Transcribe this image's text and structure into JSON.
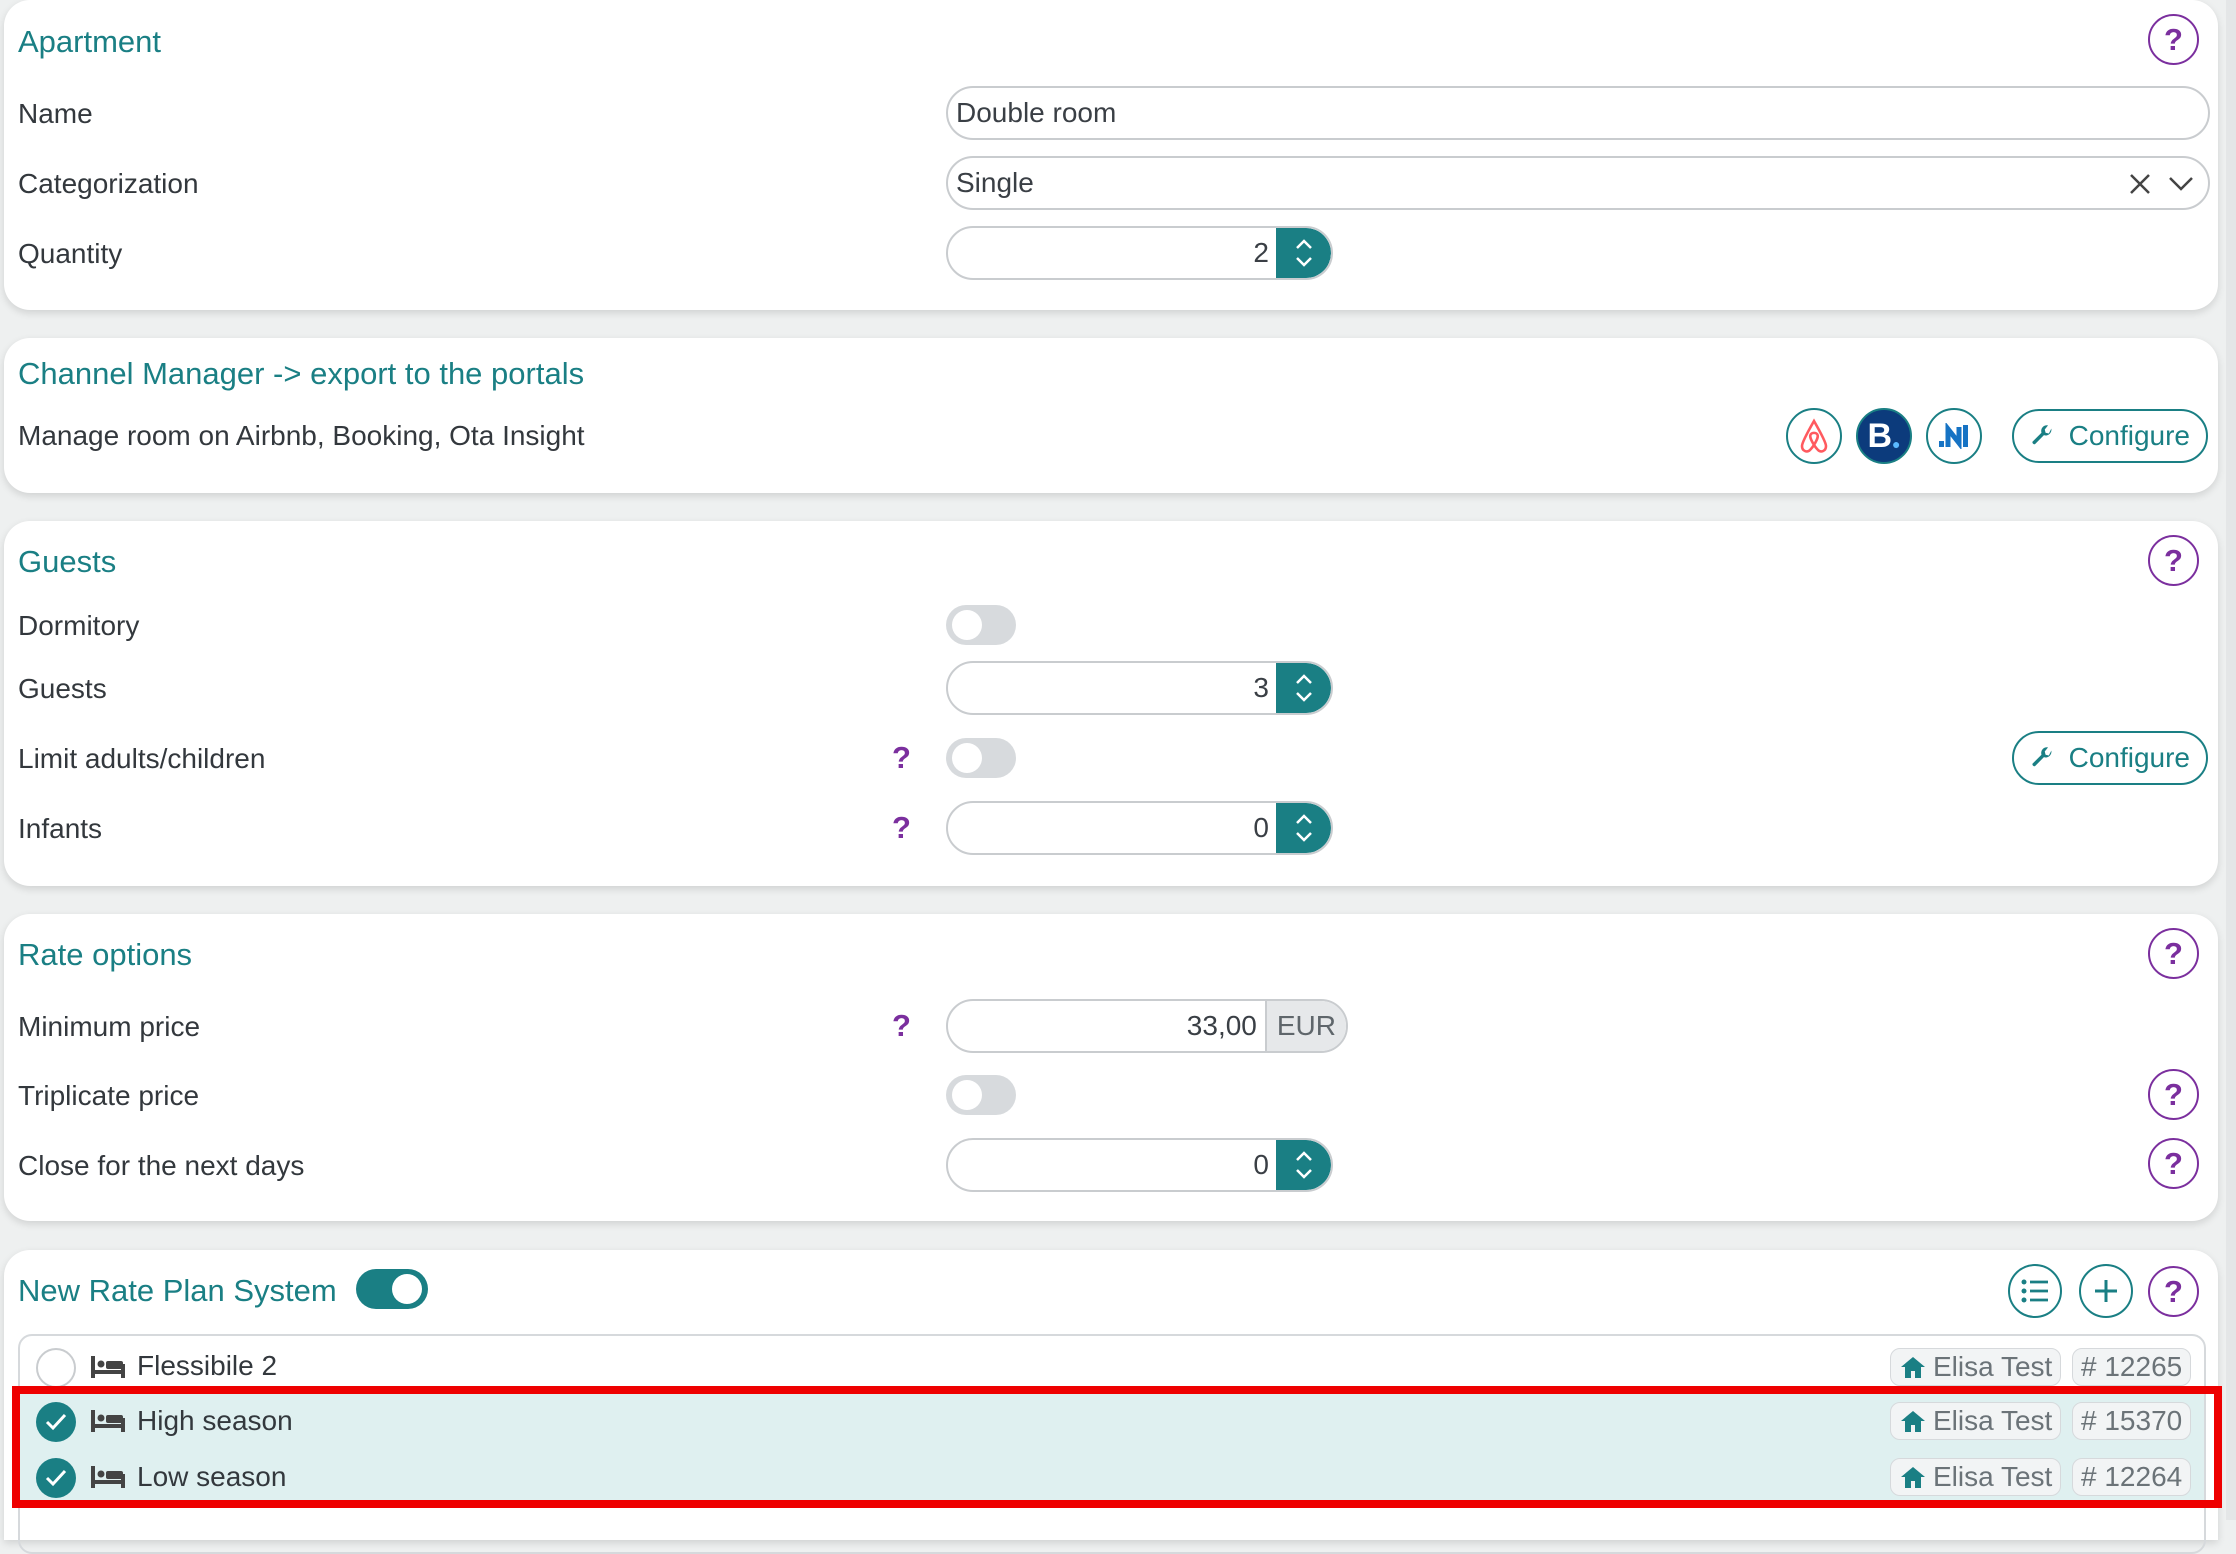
{
  "apartment": {
    "title": "Apartment",
    "help": "?",
    "name_label": "Name",
    "name_value": "Double room",
    "categorization_label": "Categorization",
    "categorization_value": "Single",
    "quantity_label": "Quantity",
    "quantity_value": "2"
  },
  "channel_manager": {
    "title": "Channel Manager -> export to the portals",
    "description": "Manage room on Airbnb, Booking, Ota Insight",
    "portals": [
      "airbnb-icon",
      "booking-icon",
      "ota-insight-icon"
    ],
    "configure_label": "Configure"
  },
  "guests": {
    "title": "Guests",
    "help": "?",
    "dormitory_label": "Dormitory",
    "guests_label": "Guests",
    "guests_value": "3",
    "limit_label": "Limit adults/children",
    "limit_help": "?",
    "configure_label": "Configure",
    "infants_label": "Infants",
    "infants_help": "?",
    "infants_value": "0"
  },
  "rate_options": {
    "title": "Rate options",
    "help": "?",
    "min_price_label": "Minimum price",
    "min_price_help": "?",
    "min_price_value": "33,00",
    "currency": "EUR",
    "triplicate_label": "Triplicate price",
    "triplicate_help": "?",
    "close_label": "Close for the next days",
    "close_help": "?",
    "close_value": "0"
  },
  "rate_plan": {
    "title": "New Rate Plan System",
    "enabled": true,
    "help": "?",
    "items": [
      {
        "name": "Flessibile 2",
        "property": "Elisa Test",
        "id": "# 12265",
        "checked": false
      },
      {
        "name": "High season",
        "property": "Elisa Test",
        "id": "# 15370",
        "checked": true
      },
      {
        "name": "Low season",
        "property": "Elisa Test",
        "id": "# 12264",
        "checked": true
      }
    ]
  },
  "colors": {
    "accent": "#1a7f84",
    "help": "#7b2f9e",
    "highlight": "#ee0000",
    "selected_row": "#dff0f0"
  }
}
